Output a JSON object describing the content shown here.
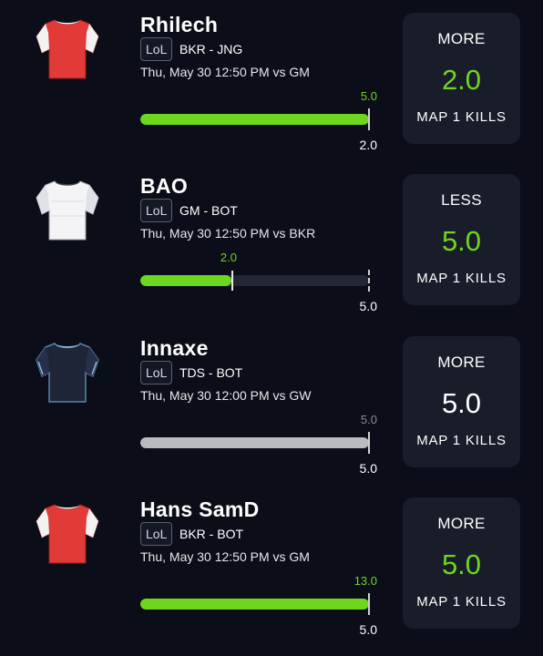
{
  "picks": [
    {
      "player": "Rhilech",
      "game": "LoL",
      "team_position": "BKR - JNG",
      "match": "Thu, May 30 12:50 PM  vs GM",
      "jersey": "red-jersey-icon",
      "bar_top_value": "5.0",
      "bar_bottom_value": "2.0",
      "progress_fraction": 1.0,
      "direction": "MORE",
      "line": "2.0",
      "stat": "MAP 1 KILLS"
    },
    {
      "player": "BAO",
      "game": "LoL",
      "team_position": "GM - BOT",
      "match": "Thu, May 30 12:50 PM  vs BKR",
      "jersey": "white-jersey-icon",
      "bar_top_value": "2.0",
      "bar_bottom_value": "5.0",
      "progress_fraction": 0.4,
      "direction": "LESS",
      "line": "5.0",
      "stat": "MAP 1 KILLS"
    },
    {
      "player": "Innaxe",
      "game": "LoL",
      "team_position": "TDS - BOT",
      "match": "Thu, May 30 12:00 PM  vs GW",
      "jersey": "navy-jersey-icon",
      "bar_top_value": "5.0",
      "bar_bottom_value": "5.0",
      "progress_fraction": 1.0,
      "direction": "MORE",
      "line": "5.0",
      "stat": "MAP 1 KILLS"
    },
    {
      "player": "Hans SamD",
      "game": "LoL",
      "team_position": "BKR - BOT",
      "match": "Thu, May 30 12:50 PM  vs GM",
      "jersey": "red-jersey-icon",
      "bar_top_value": "13.0",
      "bar_bottom_value": "5.0",
      "progress_fraction": 1.0,
      "direction": "MORE",
      "line": "5.0",
      "stat": "MAP 1 KILLS"
    }
  ],
  "colors": {
    "background": "#0b0e18",
    "card": "#191d29",
    "accent_green": "#6fd61e",
    "neutral_grey": "#b9bbc0"
  }
}
